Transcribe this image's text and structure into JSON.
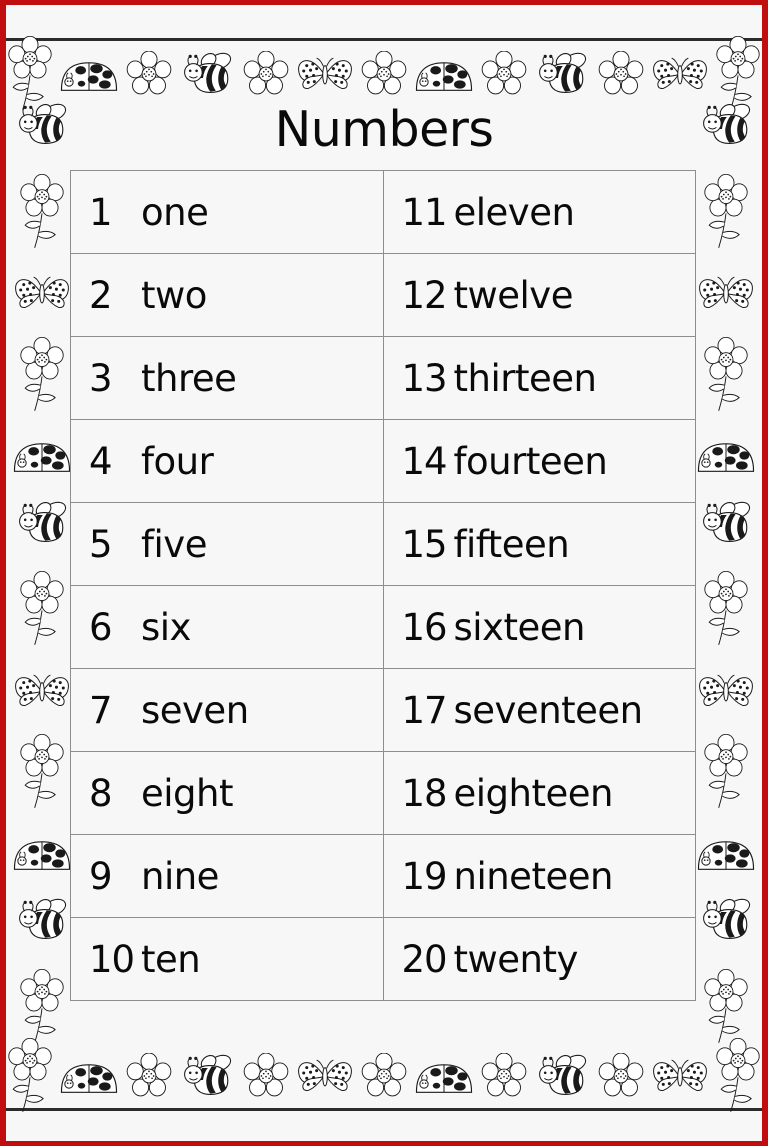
{
  "page": {
    "title": "Numbers",
    "frame_color": "#c00d0d",
    "sheet_color": "#f7f7f7",
    "ink_color": "#0a0a0a",
    "table_border_color": "#8d8d8d"
  },
  "table": {
    "columns": 2,
    "rows": [
      {
        "left": {
          "num": "1",
          "word": "one"
        },
        "right": {
          "num": "11",
          "word": "eleven"
        }
      },
      {
        "left": {
          "num": "2",
          "word": "two"
        },
        "right": {
          "num": "12",
          "word": "twelve"
        }
      },
      {
        "left": {
          "num": "3",
          "word": "three"
        },
        "right": {
          "num": "13",
          "word": "thirteen"
        }
      },
      {
        "left": {
          "num": "4",
          "word": "four"
        },
        "right": {
          "num": "14",
          "word": "fourteen"
        }
      },
      {
        "left": {
          "num": "5",
          "word": "five"
        },
        "right": {
          "num": "15",
          "word": "fifteen"
        }
      },
      {
        "left": {
          "num": "6",
          "word": "six"
        },
        "right": {
          "num": "16",
          "word": "sixteen"
        }
      },
      {
        "left": {
          "num": "7",
          "word": "seven"
        },
        "right": {
          "num": "17",
          "word": "seventeen"
        }
      },
      {
        "left": {
          "num": "8",
          "word": "eight"
        },
        "right": {
          "num": "18",
          "word": "eighteen"
        }
      },
      {
        "left": {
          "num": "9",
          "word": "nine"
        },
        "right": {
          "num": "19",
          "word": "nineteen"
        }
      },
      {
        "left": {
          "num": "10",
          "word": "ten"
        },
        "right": {
          "num": "20",
          "word": "twenty"
        }
      }
    ]
  },
  "decorations": {
    "top_border": [
      "flower-stem-icon",
      "ladybug-icon",
      "flower-icon",
      "bee-icon",
      "flower-icon",
      "butterfly-icon",
      "flower-icon",
      "ladybug-icon",
      "flower-icon",
      "bee-icon",
      "flower-icon",
      "butterfly-icon",
      "flower-stem-icon"
    ],
    "bottom_border": [
      "flower-stem-icon",
      "ladybug-icon",
      "flower-icon",
      "bee-icon",
      "flower-icon",
      "butterfly-icon",
      "flower-icon",
      "ladybug-icon",
      "flower-icon",
      "bee-icon",
      "flower-icon",
      "butterfly-icon",
      "flower-stem-icon"
    ],
    "left_border": [
      "bee-icon",
      "flower-stem-icon",
      "butterfly-icon",
      "flower-stem-icon",
      "ladybug-icon",
      "bee-icon",
      "flower-stem-icon",
      "butterfly-icon",
      "flower-stem-icon",
      "ladybug-icon",
      "bee-icon",
      "flower-stem-icon"
    ],
    "right_border": [
      "bee-icon",
      "flower-stem-icon",
      "butterfly-icon",
      "flower-stem-icon",
      "ladybug-icon",
      "bee-icon",
      "flower-stem-icon",
      "butterfly-icon",
      "flower-stem-icon",
      "ladybug-icon",
      "bee-icon",
      "flower-stem-icon"
    ]
  }
}
